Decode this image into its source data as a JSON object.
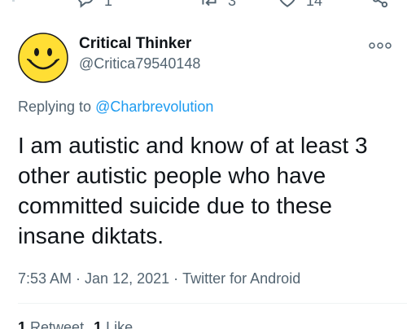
{
  "top_actions": {
    "reply_count": "1",
    "retweet_count": "3",
    "like_count": "14"
  },
  "tweet": {
    "author_name": "Critical Thinker",
    "author_handle": "@Critica79540148",
    "replying_prefix": "Replying to ",
    "replying_to": "@Charbrevolution",
    "text_lines": [
      "I am autistic and know of at least 3",
      "other autistic people who have",
      "committed suicide due to these",
      "insane diktats."
    ],
    "time": "7:53 AM",
    "date": "Jan 12, 2021",
    "source": "Twitter for Android",
    "separator": "·"
  },
  "stats": {
    "retweets_count": "1",
    "retweets_label": "Retweet",
    "likes_count": "1",
    "likes_label": "Like"
  },
  "colors": {
    "link": "#1d9bf0",
    "secondary": "#536471",
    "primary": "#0f1419",
    "avatar_yellow": "#ffde34"
  },
  "icons": [
    "reply-icon",
    "retweet-icon",
    "like-icon",
    "share-icon",
    "smiley-avatar",
    "more-options-icon"
  ]
}
